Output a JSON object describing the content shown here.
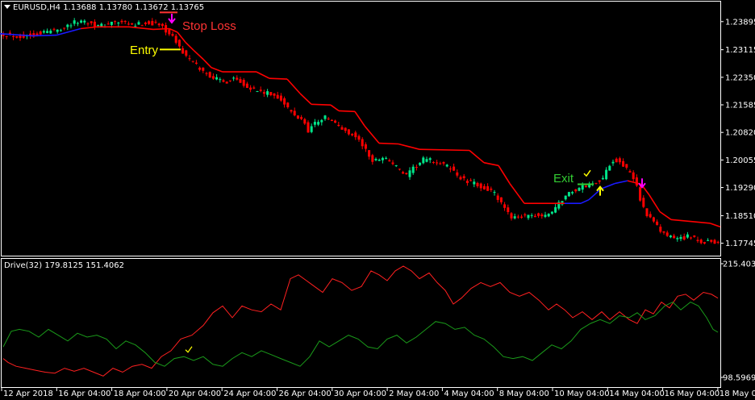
{
  "colors": {
    "background": "#000000",
    "frame": "#ffffff",
    "bull": "#00e68a",
    "bear": "#ff0000",
    "trail_short": "#ff0000",
    "trail_long": "#1a1aff",
    "stop_loss": "#ff3333",
    "entry": "#ffff00",
    "exit": "#33cc33",
    "arrow_sell": "#ff00ff",
    "arrow_buy": "#ffff00",
    "drive_red": "#ff2020",
    "drive_green": "#1a9a1a"
  },
  "main_header": "EURUSD,H4  1.13688 1.13780 1.13672 1.13765",
  "indicator_header": "Drive(32) 179.8125 151.4062",
  "annotations": {
    "stop_loss": "Stop Loss",
    "entry": "Entry",
    "exit": "Exit"
  },
  "chart_data": [
    {
      "type": "candlestick",
      "symbol": "EURUSD",
      "timeframe": "H4",
      "ohlc_header": {
        "open": 1.13688,
        "high": 1.1378,
        "low": 1.13672,
        "close": 1.13765
      },
      "yaxis_ticks": [
        1.23895,
        1.23115,
        1.2235,
        1.21585,
        1.2082,
        1.20055,
        1.1929,
        1.1851,
        1.17745
      ],
      "ylim": [
        1.174,
        1.2445
      ],
      "xaxis_ticks": [
        "12 Apr 2018",
        "16 Apr 04:00",
        "18 Apr 04:00",
        "20 Apr 04:00",
        "24 Apr 04:00",
        "26 Apr 04:00",
        "30 Apr 04:00",
        "2 May 04:00",
        "4 May 04:00",
        "8 May 04:00",
        "10 May 04:00",
        "14 May 04:00",
        "16 May 04:00",
        "18 May 04:00"
      ],
      "price_path": [
        [
          0,
          1.2357
        ],
        [
          12,
          1.2352
        ],
        [
          28,
          1.2348
        ],
        [
          44,
          1.2355
        ],
        [
          58,
          1.2362
        ],
        [
          72,
          1.2368
        ],
        [
          86,
          1.2382
        ],
        [
          100,
          1.2392
        ],
        [
          112,
          1.2387
        ],
        [
          124,
          1.2375
        ],
        [
          136,
          1.2386
        ],
        [
          150,
          1.2387
        ],
        [
          164,
          1.2378
        ],
        [
          180,
          1.2386
        ],
        [
          192,
          1.2384
        ],
        [
          202,
          1.2375
        ],
        [
          210,
          1.2355
        ],
        [
          218,
          1.2335
        ],
        [
          224,
          1.2312
        ],
        [
          232,
          1.229
        ],
        [
          242,
          1.227
        ],
        [
          252,
          1.225
        ],
        [
          264,
          1.2235
        ],
        [
          278,
          1.222
        ],
        [
          290,
          1.2235
        ],
        [
          302,
          1.2218
        ],
        [
          312,
          1.2203
        ],
        [
          322,
          1.2195
        ],
        [
          334,
          1.2188
        ],
        [
          346,
          1.218
        ],
        [
          356,
          1.215
        ],
        [
          366,
          1.2125
        ],
        [
          374,
          1.212
        ],
        [
          382,
          1.2088
        ],
        [
          392,
          1.2112
        ],
        [
          404,
          1.2125
        ],
        [
          416,
          1.2105
        ],
        [
          426,
          1.2088
        ],
        [
          440,
          1.2072
        ],
        [
          450,
          1.2045
        ],
        [
          462,
          1.2
        ],
        [
          474,
          1.2015
        ],
        [
          484,
          1.2002
        ],
        [
          494,
          1.198
        ],
        [
          504,
          1.196
        ],
        [
          514,
          1.1985
        ],
        [
          526,
          1.2008
        ],
        [
          538,
          1.2002
        ],
        [
          548,
          1.1992
        ],
        [
          558,
          1.1985
        ],
        [
          568,
          1.196
        ],
        [
          578,
          1.1945
        ],
        [
          590,
          1.1938
        ],
        [
          600,
          1.1928
        ],
        [
          612,
          1.1915
        ],
        [
          622,
          1.188
        ],
        [
          632,
          1.1848
        ],
        [
          642,
          1.1852
        ],
        [
          652,
          1.1845
        ],
        [
          664,
          1.1852
        ],
        [
          676,
          1.1848
        ],
        [
          688,
          1.1872
        ],
        [
          700,
          1.1905
        ],
        [
          712,
          1.1922
        ],
        [
          724,
          1.1932
        ],
        [
          736,
          1.1942
        ],
        [
          748,
          1.1955
        ],
        [
          758,
          1.2005
        ],
        [
          768,
          1.2005
        ],
        [
          778,
          1.1975
        ],
        [
          788,
          1.1945
        ],
        [
          796,
          1.1878
        ],
        [
          806,
          1.1842
        ],
        [
          818,
          1.181
        ],
        [
          830,
          1.179
        ],
        [
          842,
          1.1788
        ],
        [
          854,
          1.1795
        ],
        [
          866,
          1.1778
        ],
        [
          876,
          1.178
        ],
        [
          886,
          1.1778
        ],
        [
          893,
          1.1776
        ]
      ],
      "trail_line": [
        [
          0,
          1.2356
        ],
        [
          40,
          1.235
        ],
        [
          70,
          1.2352
        ],
        [
          100,
          1.237
        ],
        [
          120,
          1.2375
        ],
        [
          160,
          1.2375
        ],
        [
          190,
          1.2368
        ],
        [
          210,
          1.237
        ],
        [
          220,
          1.236
        ],
        [
          230,
          1.2332
        ],
        [
          240,
          1.231
        ],
        [
          252,
          1.2285
        ],
        [
          262,
          1.2262
        ],
        [
          276,
          1.225
        ],
        [
          318,
          1.225
        ],
        [
          334,
          1.2232
        ],
        [
          356,
          1.223
        ],
        [
          372,
          1.219
        ],
        [
          386,
          1.216
        ],
        [
          410,
          1.2158
        ],
        [
          420,
          1.2142
        ],
        [
          440,
          1.214
        ],
        [
          452,
          1.21
        ],
        [
          470,
          1.2052
        ],
        [
          494,
          1.205
        ],
        [
          520,
          1.2035
        ],
        [
          582,
          1.2032
        ],
        [
          600,
          1.1998
        ],
        [
          618,
          1.199
        ],
        [
          632,
          1.194
        ],
        [
          650,
          1.1885
        ],
        [
          700,
          1.1885
        ],
        [
          720,
          1.1885
        ],
        [
          730,
          1.1895
        ],
        [
          745,
          1.1925
        ],
        [
          762,
          1.194
        ],
        [
          778,
          1.1948
        ],
        [
          795,
          1.1938
        ],
        [
          805,
          1.1908
        ],
        [
          818,
          1.1862
        ],
        [
          832,
          1.184
        ],
        [
          880,
          1.183
        ],
        [
          893,
          1.182
        ]
      ],
      "trail_long_segments": [
        [
          0,
          95
        ],
        [
          705,
          770
        ]
      ],
      "markers": {
        "stop_loss_line": {
          "x": [
            198,
            220
          ],
          "y": 1.2415
        },
        "entry_line": {
          "x": [
            198,
            224
          ],
          "y": 1.2312
        },
        "exit_line": {
          "x": [
            716,
            736
          ],
          "y": 1.1938
        },
        "sell_arrows": [
          [
            213,
            1.2398
          ],
          [
            796,
            1.1941
          ]
        ],
        "buy_arrows": [
          [
            744,
            1.192
          ]
        ],
        "checkmarks": [
          [
            727,
            1.1968
          ]
        ]
      }
    },
    {
      "type": "line",
      "name": "Drive(32)",
      "values_header": [
        179.8125,
        151.4062
      ],
      "yaxis_ticks": [
        215.4031,
        98.5969
      ],
      "ylim": [
        98.5969,
        215.4031
      ],
      "series": [
        {
          "color": "red",
          "points": [
            [
              4,
              118
            ],
            [
              10,
              114
            ],
            [
              20,
              110
            ],
            [
              32,
              108
            ],
            [
              44,
              106
            ],
            [
              56,
              104
            ],
            [
              68,
              103
            ],
            [
              80,
              108
            ],
            [
              92,
              105
            ],
            [
              104,
              108
            ],
            [
              116,
              104
            ],
            [
              128,
              100
            ],
            [
              140,
              108
            ],
            [
              152,
              104
            ],
            [
              164,
              110
            ],
            [
              176,
              112
            ],
            [
              188,
              108
            ],
            [
              200,
              120
            ],
            [
              212,
              126
            ],
            [
              224,
              138
            ],
            [
              238,
              142
            ],
            [
              252,
              152
            ],
            [
              264,
              165
            ],
            [
              276,
              172
            ],
            [
              288,
              160
            ],
            [
              300,
              172
            ],
            [
              312,
              168
            ],
            [
              324,
              166
            ],
            [
              336,
              174
            ],
            [
              348,
              168
            ],
            [
              360,
              200
            ],
            [
              370,
              204
            ],
            [
              380,
              198
            ],
            [
              390,
              192
            ],
            [
              400,
              186
            ],
            [
              412,
              200
            ],
            [
              424,
              196
            ],
            [
              436,
              188
            ],
            [
              448,
              192
            ],
            [
              460,
              208
            ],
            [
              470,
              204
            ],
            [
              480,
              198
            ],
            [
              490,
              208
            ],
            [
              500,
              213
            ],
            [
              510,
              208
            ],
            [
              520,
              200
            ],
            [
              532,
              206
            ],
            [
              542,
              196
            ],
            [
              552,
              188
            ],
            [
              562,
              174
            ],
            [
              572,
              180
            ],
            [
              584,
              190
            ],
            [
              596,
              196
            ],
            [
              608,
              192
            ],
            [
              620,
              196
            ],
            [
              632,
              186
            ],
            [
              644,
              182
            ],
            [
              656,
              186
            ],
            [
              668,
              178
            ],
            [
              680,
              168
            ],
            [
              690,
              174
            ],
            [
              700,
              168
            ],
            [
              710,
              160
            ],
            [
              722,
              166
            ],
            [
              734,
              158
            ],
            [
              746,
              166
            ],
            [
              756,
              158
            ],
            [
              768,
              166
            ],
            [
              780,
              158
            ],
            [
              790,
              154
            ],
            [
              800,
              168
            ],
            [
              810,
              164
            ],
            [
              820,
              176
            ],
            [
              830,
              170
            ],
            [
              840,
              182
            ],
            [
              850,
              184
            ],
            [
              860,
              178
            ],
            [
              872,
              186
            ],
            [
              882,
              184
            ],
            [
              890,
              180
            ]
          ]
        },
        {
          "color": "green",
          "points": [
            [
              4,
              130
            ],
            [
              14,
              146
            ],
            [
              24,
              148
            ],
            [
              36,
              146
            ],
            [
              48,
              140
            ],
            [
              60,
              148
            ],
            [
              72,
              142
            ],
            [
              84,
              136
            ],
            [
              96,
              144
            ],
            [
              108,
              140
            ],
            [
              120,
              142
            ],
            [
              132,
              138
            ],
            [
              144,
              128
            ],
            [
              156,
              136
            ],
            [
              168,
              132
            ],
            [
              180,
              124
            ],
            [
              192,
              114
            ],
            [
              204,
              110
            ],
            [
              216,
              118
            ],
            [
              228,
              120
            ],
            [
              240,
              116
            ],
            [
              252,
              120
            ],
            [
              264,
              112
            ],
            [
              276,
              110
            ],
            [
              288,
              118
            ],
            [
              300,
              124
            ],
            [
              312,
              120
            ],
            [
              324,
              126
            ],
            [
              336,
              122
            ],
            [
              348,
              118
            ],
            [
              360,
              114
            ],
            [
              372,
              110
            ],
            [
              384,
              120
            ],
            [
              396,
              136
            ],
            [
              408,
              130
            ],
            [
              420,
              136
            ],
            [
              432,
              142
            ],
            [
              444,
              138
            ],
            [
              456,
              130
            ],
            [
              468,
              128
            ],
            [
              480,
              138
            ],
            [
              492,
              142
            ],
            [
              504,
              134
            ],
            [
              516,
              140
            ],
            [
              528,
              148
            ],
            [
              540,
              156
            ],
            [
              552,
              154
            ],
            [
              564,
              148
            ],
            [
              576,
              150
            ],
            [
              588,
              142
            ],
            [
              600,
              138
            ],
            [
              612,
              130
            ],
            [
              624,
              120
            ],
            [
              636,
              118
            ],
            [
              648,
              120
            ],
            [
              660,
              116
            ],
            [
              672,
              124
            ],
            [
              684,
              132
            ],
            [
              696,
              128
            ],
            [
              708,
              136
            ],
            [
              720,
              148
            ],
            [
              732,
              154
            ],
            [
              744,
              158
            ],
            [
              756,
              154
            ],
            [
              768,
              162
            ],
            [
              780,
              160
            ],
            [
              790,
              165
            ],
            [
              800,
              158
            ],
            [
              812,
              162
            ],
            [
              824,
              172
            ],
            [
              834,
              176
            ],
            [
              844,
              168
            ],
            [
              856,
              176
            ],
            [
              866,
              172
            ],
            [
              876,
              160
            ],
            [
              884,
              148
            ],
            [
              890,
              145
            ]
          ]
        }
      ],
      "markers": {
        "checkmarks": [
          [
            233,
            127
          ]
        ]
      }
    }
  ]
}
